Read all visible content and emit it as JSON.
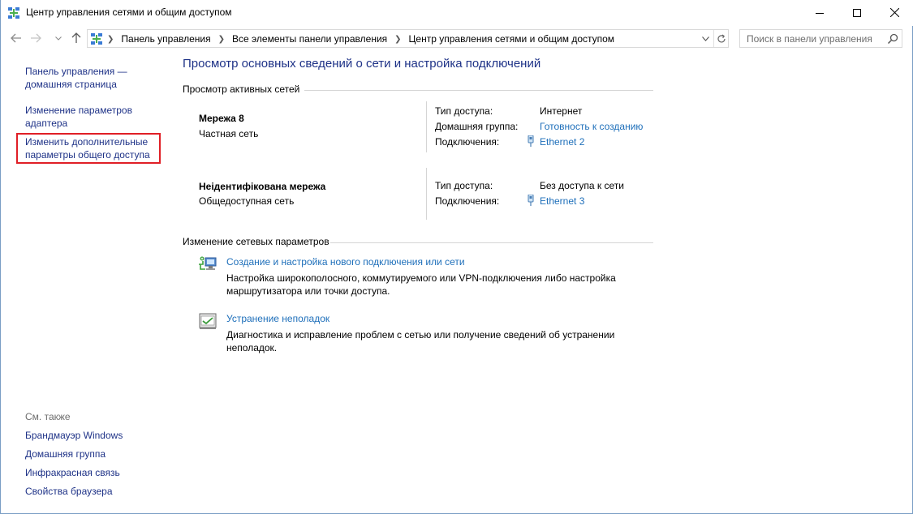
{
  "window": {
    "title": "Центр управления сетями и общим доступом"
  },
  "nav": {
    "breadcrumbs": [
      "Панель управления",
      "Все элементы панели управления",
      "Центр управления сетями и общим доступом"
    ],
    "search_placeholder": "Поиск в панели управления"
  },
  "sidebar": {
    "home_label": "Панель управления — домашняя страница",
    "adapter_label": "Изменение параметров адаптера",
    "sharing_label": "Изменить дополнительные параметры общего доступа",
    "see_also_heading": "См. также",
    "see_also": [
      "Брандмауэр Windows",
      "Домашняя группа",
      "Инфракрасная связь",
      "Свойства браузера"
    ]
  },
  "main": {
    "title": "Просмотр основных сведений о сети и настройка подключений",
    "active_networks_heading": "Просмотр активных сетей",
    "networks": [
      {
        "name": "Мережа  8",
        "type": "Частная сеть",
        "access_label": "Тип доступа:",
        "access_value": "Интернет",
        "homegroup_label": "Домашняя группа:",
        "homegroup_value": "Готовность к созданию",
        "connections_label": "Подключения:",
        "connection_value": "Ethernet 2"
      },
      {
        "name": "Неідентифікована мережа",
        "type": "Общедоступная сеть",
        "access_label": "Тип доступа:",
        "access_value": "Без доступа к сети",
        "connections_label": "Подключения:",
        "connection_value": "Ethernet 3"
      }
    ],
    "change_settings_heading": "Изменение сетевых параметров",
    "tasks": [
      {
        "icon": "new-connection-icon",
        "link": "Создание и настройка нового подключения или сети",
        "description": "Настройка широкополосного, коммутируемого или VPN-подключения либо настройка маршрутизатора или точки доступа."
      },
      {
        "icon": "troubleshoot-icon",
        "link": "Устранение неполадок",
        "description": "Диагностика и исправление проблем с сетью или получение сведений об устранении неполадок."
      }
    ]
  },
  "colors": {
    "link_dark": "#1e3287",
    "link_blue": "#1e6fba",
    "highlight_box": "#e01f26",
    "separator": "#d5d5d5"
  }
}
